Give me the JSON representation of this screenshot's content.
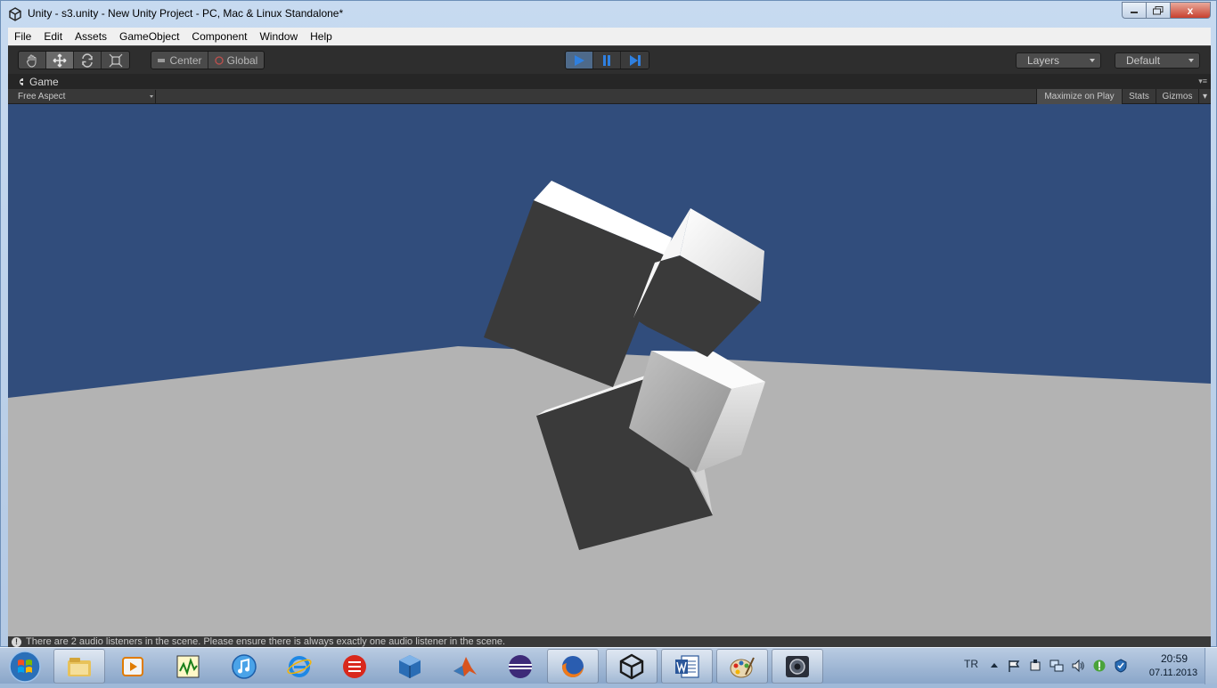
{
  "window": {
    "title": "Unity - s3.unity - New Unity Project - PC, Mac & Linux Standalone*",
    "close_glyph": "x"
  },
  "menu": [
    "File",
    "Edit",
    "Assets",
    "GameObject",
    "Component",
    "Window",
    "Help"
  ],
  "toolbar": {
    "tools": [
      "hand-icon",
      "move-icon",
      "rotate-icon",
      "scale-icon"
    ],
    "active_tool": "move-icon",
    "pivot_label": "Center",
    "space_label": "Global",
    "play_state": "playing",
    "layers_label": "Layers",
    "layout_label": "Default"
  },
  "game_view": {
    "tab_label": "Game",
    "aspect_label": "Free Aspect",
    "maximize_label": "Maximize on Play",
    "stats_label": "Stats",
    "gizmos_label": "Gizmos",
    "sky_color": "#314d7c",
    "ground_color": "#b3b3b3"
  },
  "status": {
    "message": "There are 2 audio listeners in the scene. Please ensure there is always exactly one audio listener in the scene."
  },
  "taskbar": {
    "pinned": [
      "explorer-icon",
      "media-player-icon",
      "circuit-app-icon",
      "itunes-icon",
      "internet-explorer-icon",
      "app-red-icon",
      "virtualbox-icon",
      "matlab-icon",
      "eclipse-icon",
      "firefox-icon",
      "unity-icon",
      "word-icon",
      "paint-icon",
      "camera-app-icon"
    ],
    "open": [
      "explorer-icon",
      "firefox-icon",
      "unity-icon",
      "word-icon",
      "paint-icon",
      "camera-app-icon"
    ]
  },
  "tray": {
    "language": "TR",
    "time": "20:59",
    "date": "07.11.2013"
  }
}
